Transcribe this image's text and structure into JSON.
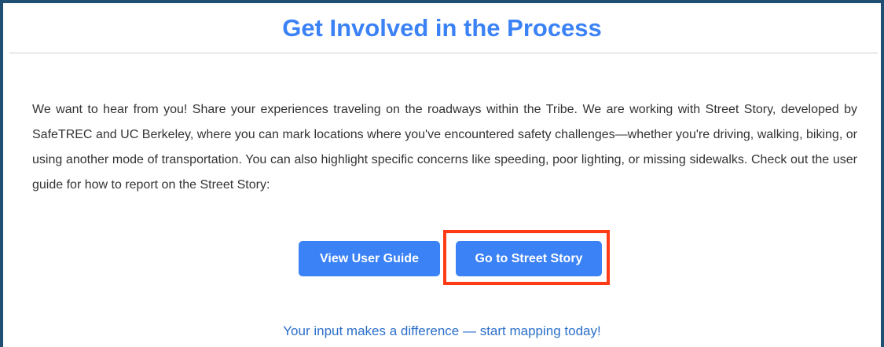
{
  "section": {
    "title": "Get Involved in the Process",
    "body": "We want to hear from you! Share your experiences traveling on the roadways within the Tribe. We are working with Street Story, developed by SafeTREC and UC Berkeley, where you can mark locations where you've encountered safety challenges—whether you're driving, walking, biking, or using another mode of transportation. You can also highlight specific concerns like speeding, poor lighting, or missing sidewalks. Check out the user guide for how to report on the Street Story:",
    "footer": "Your input makes a difference — start mapping today!"
  },
  "buttons": {
    "view_user_guide": "View User Guide",
    "go_to_street_story": "Go to Street Story"
  },
  "colors": {
    "accent": "#3b82f6",
    "frame": "#1f4f73",
    "highlight": "#ff3b16",
    "footer_text": "#2b6fc9",
    "body_text": "#333333"
  }
}
